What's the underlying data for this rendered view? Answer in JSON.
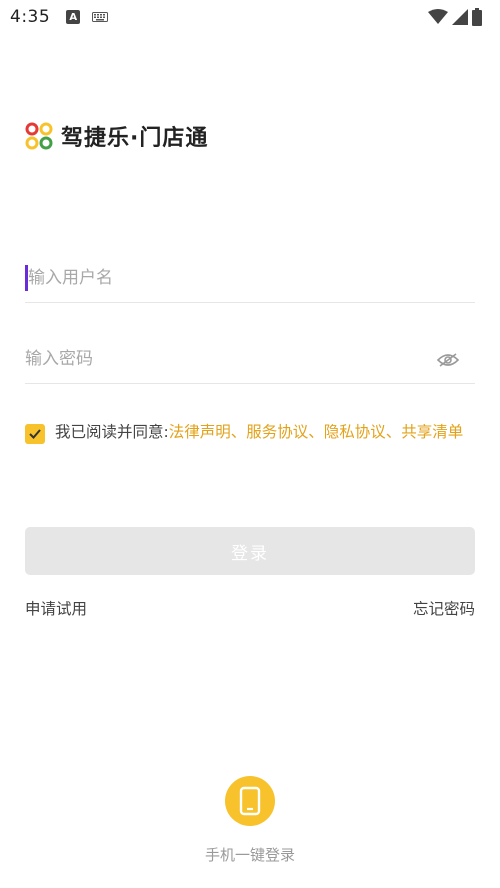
{
  "status_bar": {
    "time": "4:35",
    "left_icons": [
      "app-a-icon",
      "keyboard-icon"
    ],
    "right_icons": [
      "wifi-icon",
      "signal-icon",
      "battery-icon"
    ]
  },
  "logo": {
    "text": "驾捷乐·门店通",
    "dot_colors": [
      "#e53935",
      "#f7c22b",
      "#f7c22b",
      "#43a047"
    ]
  },
  "form": {
    "username_placeholder": "输入用户名",
    "password_placeholder": "输入密码",
    "password_toggle_icon": "eye-icon"
  },
  "agreement": {
    "checked": true,
    "prefix": "我已阅读并同意:",
    "links": "法律声明、服务协议、隐私协议、共享清单"
  },
  "login_button": {
    "label": "登录"
  },
  "links": {
    "apply_trial": "申请试用",
    "forgot_password": "忘记密码"
  },
  "phone_login": {
    "label": "手机一键登录",
    "icon": "phone-icon"
  },
  "colors": {
    "accent": "#f7c22b",
    "link": "#e3a21a",
    "caret": "#6a2bd9",
    "disabled_button": "#e6e6e6"
  }
}
